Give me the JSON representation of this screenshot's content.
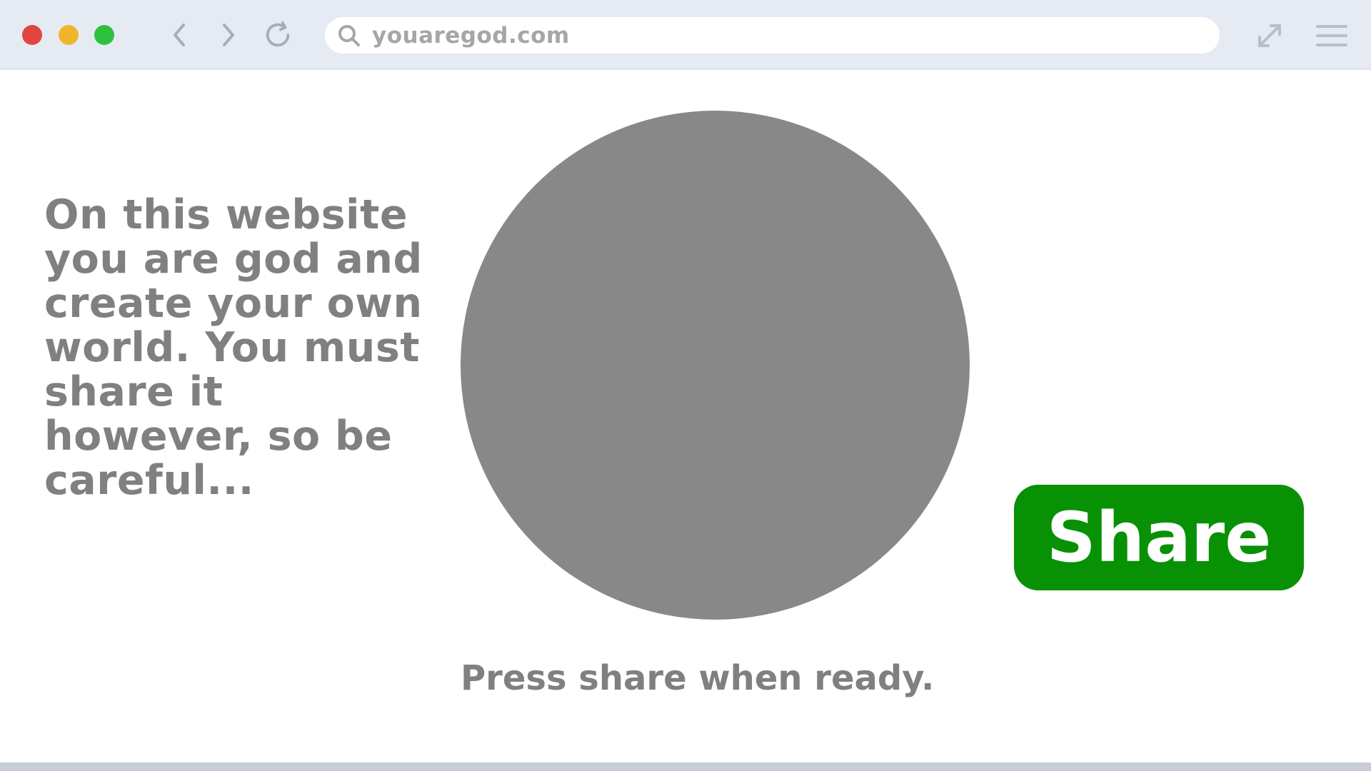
{
  "browser": {
    "url": "youaregod.com",
    "window_controls": [
      "close",
      "minimize",
      "maximize"
    ],
    "nav": {
      "back_icon": "chevron-left-icon",
      "forward_icon": "chevron-right-icon",
      "reload_icon": "reload-icon",
      "search_icon": "search-icon",
      "expand_icon": "expand-icon",
      "menu_icon": "hamburger-menu-icon"
    }
  },
  "page": {
    "intro_text": "On this website you are god and create your own world. You must share it however, so be careful...",
    "share_label": "Share",
    "hint": "Press share when ready."
  },
  "colors": {
    "chrome": "#e6ebf3",
    "traffic_red": "#e0453f",
    "traffic_yellow": "#f0b62b",
    "traffic_green": "#2cc23e",
    "text_gray": "#808080",
    "circle_gray": "#888888",
    "share_green": "#089104"
  }
}
